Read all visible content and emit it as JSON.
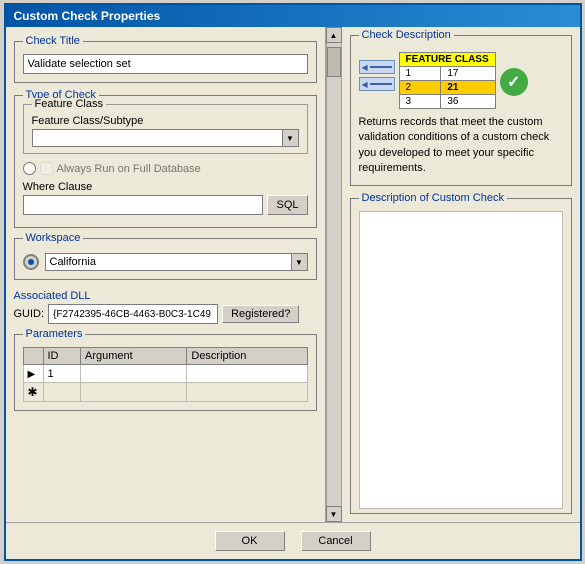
{
  "dialog": {
    "title": "Custom Check Properties",
    "ok_label": "OK",
    "cancel_label": "Cancel"
  },
  "left": {
    "check_title_label": "Check Title",
    "check_title_value": "Validate selection set",
    "type_of_check_label": "Type of Check",
    "feature_class_label": "Feature Class",
    "feature_class_subtype_label": "Feature Class/Subtype",
    "feature_class_value": "",
    "always_run_label": "Always Run on Full Database",
    "where_clause_label": "Where Clause",
    "where_clause_value": "",
    "sql_label": "SQL",
    "workspace_label": "Workspace",
    "workspace_value": "California",
    "associated_dll_label": "Associated DLL",
    "guid_label": "GUID:",
    "guid_value": "{F2742395-46CB-4463-B0C3-1C49",
    "registered_label": "Registered?",
    "parameters_label": "Parameters",
    "params_columns": [
      "ID",
      "Argument",
      "Description"
    ],
    "params_rows": [
      {
        "id": "1",
        "argument": "",
        "description": "",
        "selected": true
      },
      {
        "id": "",
        "argument": "",
        "description": "",
        "is_new": true
      }
    ]
  },
  "right": {
    "check_description_label": "Check Description",
    "feature_class_table": {
      "header": "FEATURE CLASS",
      "rows": [
        {
          "num": "1",
          "val": "17",
          "highlighted": false
        },
        {
          "num": "2",
          "val": "21",
          "highlighted": true
        },
        {
          "num": "3",
          "val": "36",
          "highlighted": false
        }
      ]
    },
    "description_text": "Returns records that meet the custom validation conditions of a custom check you developed to meet your specific requirements.",
    "custom_desc_label": "Description of Custom Check"
  }
}
